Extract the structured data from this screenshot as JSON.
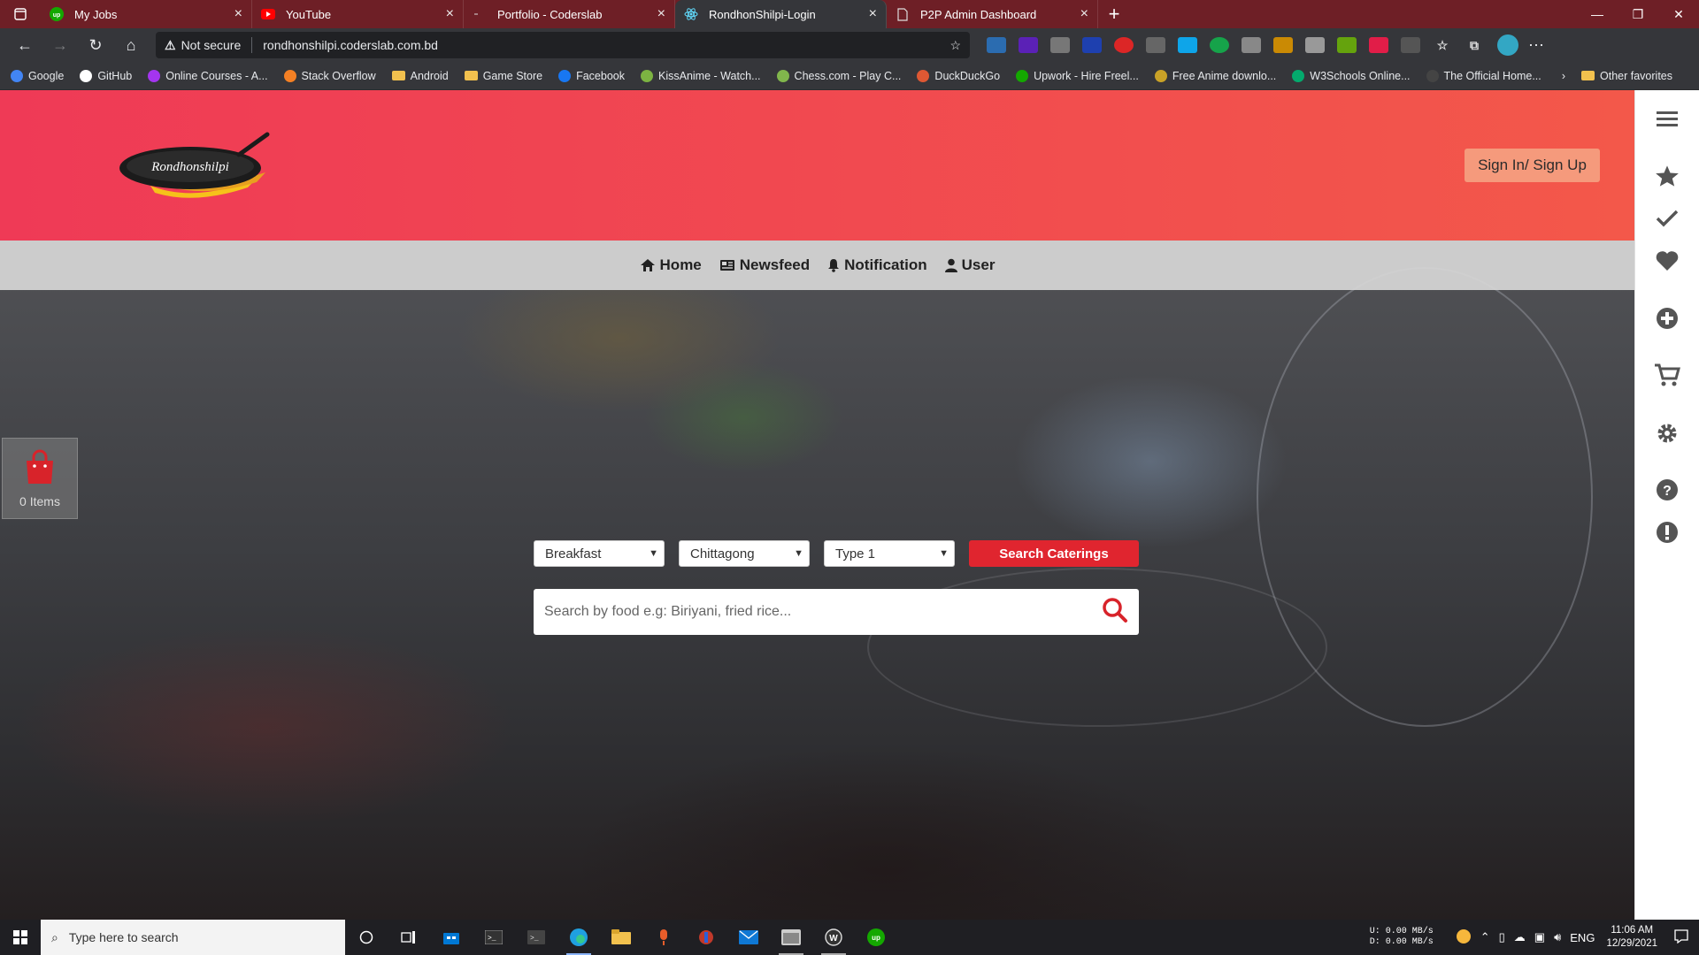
{
  "browser": {
    "tabs": [
      {
        "title": "My Jobs",
        "favicon": "upwork-icon",
        "active": false
      },
      {
        "title": "YouTube",
        "favicon": "youtube-icon",
        "active": false
      },
      {
        "title": "Portfolio - Coderslab",
        "favicon": "coderslab-icon",
        "active": false
      },
      {
        "title": "RondhonShilpi-Login",
        "favicon": "react-icon",
        "active": true
      },
      {
        "title": "P2P Admin Dashboard",
        "favicon": "page-icon",
        "active": false
      }
    ],
    "security_label": "Not secure",
    "url": "rondhonshilpi.coderslab.com.bd",
    "bookmarks": [
      {
        "label": "Google",
        "color": "#4285f4"
      },
      {
        "label": "GitHub",
        "color": "#ffffff"
      },
      {
        "label": "Online Courses - A...",
        "color": "#a435f0"
      },
      {
        "label": "Stack Overflow",
        "color": "#f48024"
      },
      {
        "label": "Android",
        "folder": true
      },
      {
        "label": "Game Store",
        "folder": true
      },
      {
        "label": "Facebook",
        "color": "#1877f2"
      },
      {
        "label": "KissAnime - Watch...",
        "color": "#7cb342"
      },
      {
        "label": "Chess.com - Play C...",
        "color": "#81b64c"
      },
      {
        "label": "DuckDuckGo",
        "color": "#de5833"
      },
      {
        "label": "Upwork - Hire Freel...",
        "color": "#14a800"
      },
      {
        "label": "Free Anime downlo...",
        "color": "#c9a227"
      },
      {
        "label": "W3Schools Online...",
        "color": "#04aa6d"
      },
      {
        "label": "The Official Home...",
        "color": "#444444"
      }
    ],
    "other_favorites": "Other favorites"
  },
  "site": {
    "signin_label": "Sign In/ Sign Up",
    "nav": [
      {
        "label": "Home",
        "icon": "home-icon"
      },
      {
        "label": "Newsfeed",
        "icon": "newspaper-icon"
      },
      {
        "label": "Notification",
        "icon": "bell-icon"
      },
      {
        "label": "User",
        "icon": "user-icon"
      }
    ],
    "cart": {
      "count_label": "0 Items"
    },
    "filters": {
      "meal": "Breakfast",
      "city": "Chittagong",
      "type": "Type 1"
    },
    "search_button": "Search Caterings",
    "food_search_placeholder": "Search by food e.g: Biriyani, fried rice...",
    "logo_text": "Rondhonshilpi",
    "colors": {
      "header_start": "#ef3a56",
      "header_end": "#f3584a",
      "button_red": "#e0252f",
      "signin_bg": "#f59a7c"
    }
  },
  "sidepanel": [
    "menu-icon",
    "star-icon",
    "check-icon",
    "heart-icon",
    "plus-circle-icon",
    "cart-icon",
    "gear-icon",
    "question-icon",
    "alert-icon"
  ],
  "taskbar": {
    "search_placeholder": "Type here to search",
    "net_up": "U:   0.00 MB/s",
    "net_down": "D:   0.00 MB/s",
    "lang": "ENG",
    "time": "11:06 AM",
    "date": "12/29/2021"
  }
}
